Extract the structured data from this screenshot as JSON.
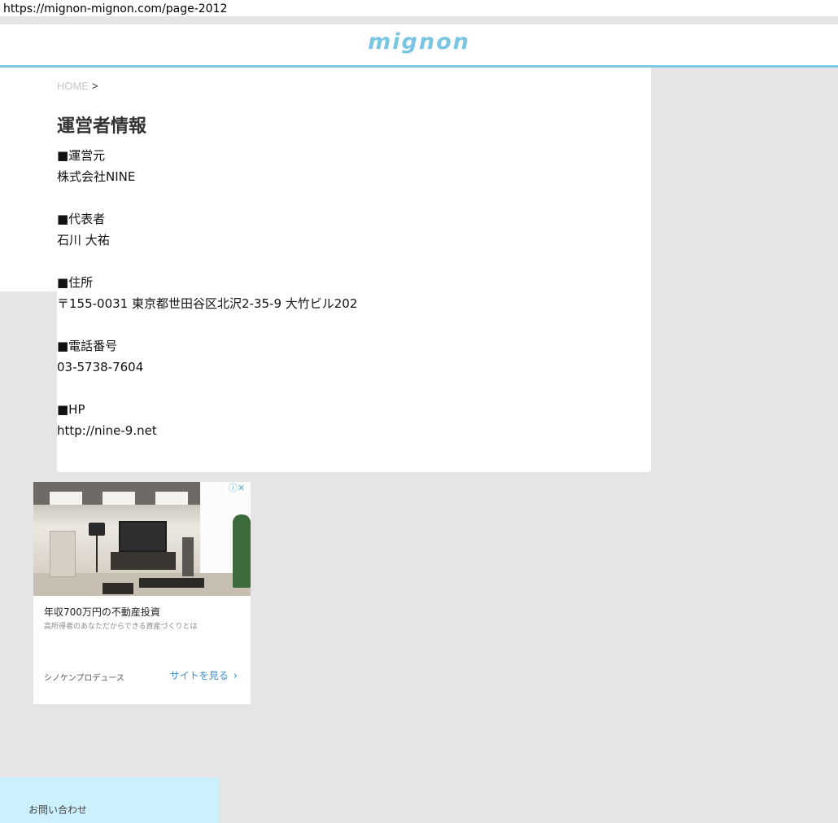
{
  "browser": {
    "url": "https://mignon-mignon.com/page-2012"
  },
  "header": {
    "logo": "mignon",
    "accent_color": "#7ec9e3"
  },
  "breadcrumb": {
    "home": "HOME",
    "separator": ">"
  },
  "page": {
    "title": "運営者情報"
  },
  "info": {
    "operator_label": "■運営元",
    "operator_value": "株式会社NINE",
    "representative_label": "■代表者",
    "representative_value": "石川 大祐",
    "address_label": "■住所",
    "address_value": "〒155-0031 東京都世田谷区北沢2-35-9 大竹ビル202",
    "phone_label": "■電話番号",
    "phone_value": "03-5738-7604",
    "hp_label": "■HP",
    "hp_value": "http://nine-9.net"
  },
  "ad": {
    "choices_icons": [
      "info-icon",
      "close-icon"
    ],
    "title": "年収700万円の不動産投資",
    "description": "高所得者のあなただからできる資産づくりとは",
    "advertiser": "シノケンプロデュース",
    "cta": "サイトを見る",
    "cta_icon": "chevron-right-icon"
  },
  "footer": {
    "contact": "お問い合わせ",
    "bg_color": "#ccf1fd"
  }
}
